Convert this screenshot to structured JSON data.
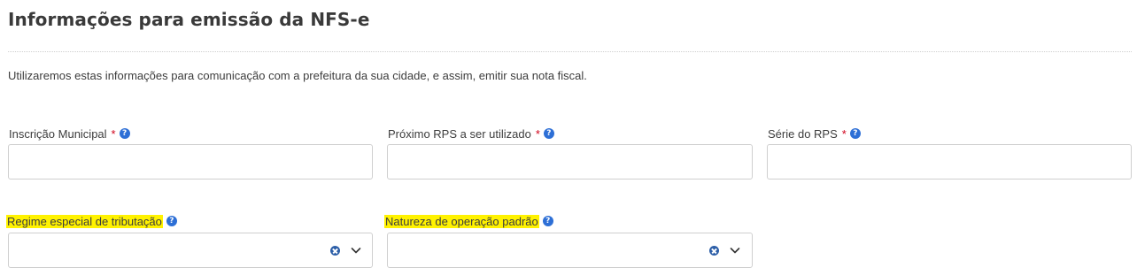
{
  "header": {
    "title": "Informações para emissão da NFS-e"
  },
  "description": "Utilizaremos estas informações para comunicação com a prefeitura da sua cidade, e assim, emitir sua nota fiscal.",
  "fields": {
    "inscricao_municipal": {
      "label": "Inscrição Municipal",
      "required": "*",
      "help": "?",
      "value": ""
    },
    "proximo_rps": {
      "label": "Próximo RPS a ser utilizado",
      "required": "*",
      "help": "?",
      "value": ""
    },
    "serie_rps": {
      "label": "Série do RPS",
      "required": "*",
      "help": "?",
      "value": ""
    },
    "regime_especial": {
      "label": "Regime especial de tributação",
      "help": "?",
      "value": ""
    },
    "natureza_operacao": {
      "label": "Natureza de operação padrão",
      "help": "?",
      "value": ""
    }
  },
  "icons": {
    "help": "help-icon",
    "clear": "clear-icon",
    "chevron": "chevron-down-icon"
  },
  "colors": {
    "highlight": "#fff200",
    "required": "#d0021b",
    "help_icon": "#2d6fd6",
    "border": "#cfcfcf"
  }
}
